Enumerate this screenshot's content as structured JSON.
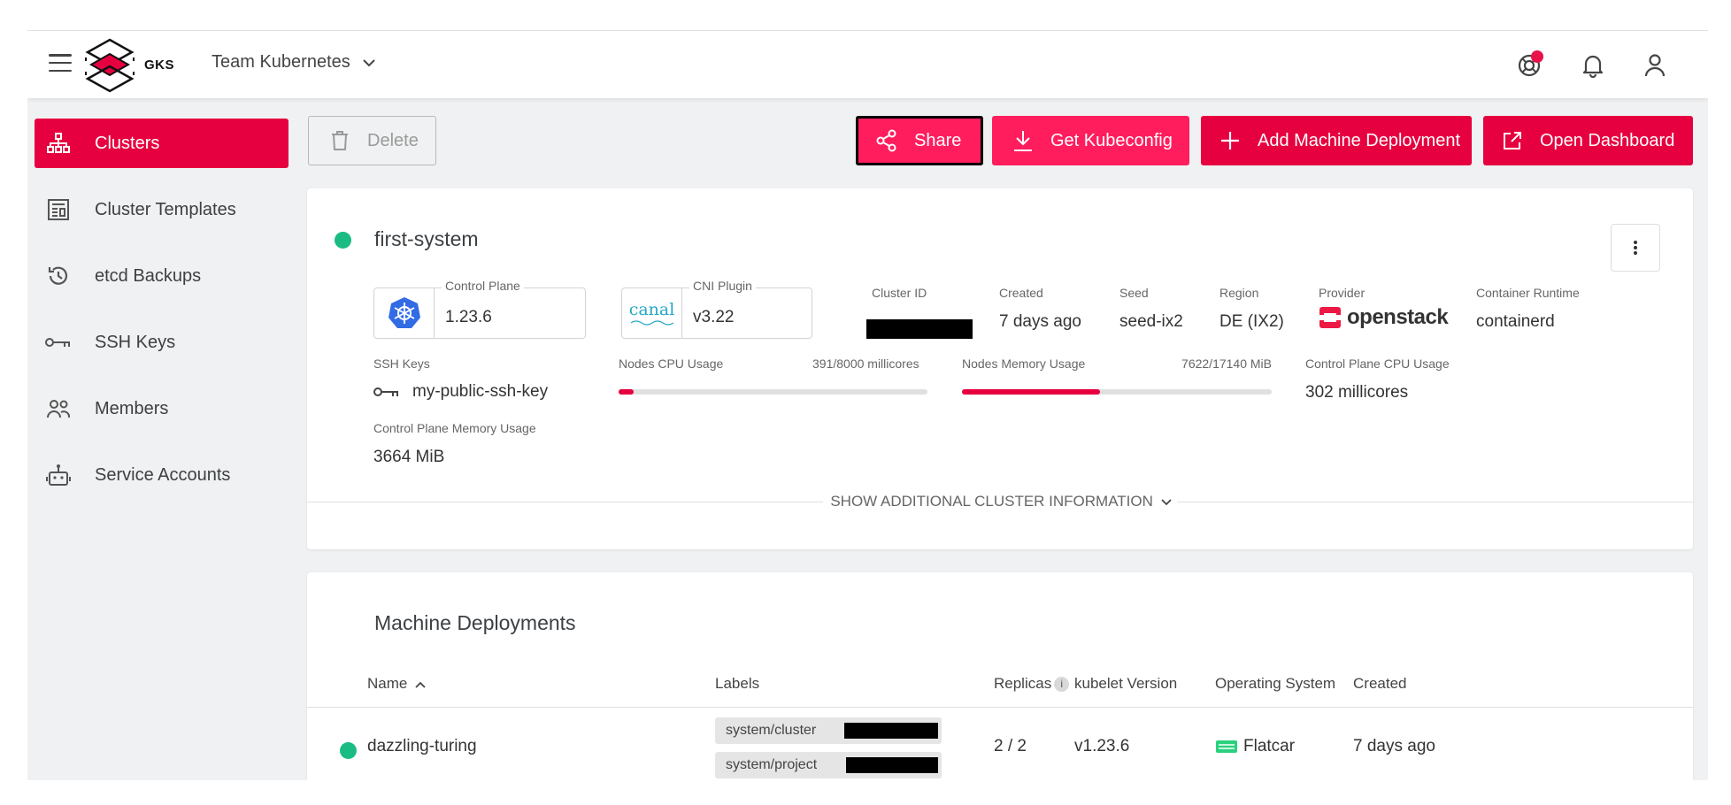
{
  "header": {
    "logo_text": "GKS",
    "project": "Team Kubernetes"
  },
  "sidebar": {
    "items": [
      {
        "label": "Clusters",
        "icon": "sitemap-icon",
        "active": true
      },
      {
        "label": "Cluster Templates",
        "icon": "template-icon"
      },
      {
        "label": "etcd Backups",
        "icon": "history-icon"
      },
      {
        "label": "SSH Keys",
        "icon": "key-icon"
      },
      {
        "label": "Members",
        "icon": "members-icon"
      },
      {
        "label": "Service Accounts",
        "icon": "robot-icon"
      }
    ]
  },
  "toolbar": {
    "delete_label": "Delete",
    "share_label": "Share",
    "kubeconfig_label": "Get Kubeconfig",
    "add_md_label": "Add Machine Deployment",
    "dashboard_label": "Open Dashboard"
  },
  "cluster": {
    "name": "first-system",
    "status_color": "#1bbc84",
    "control_plane_label": "Control Plane",
    "control_plane_version": "1.23.6",
    "cni_label": "CNI Plugin",
    "cni_logo_text": "canal",
    "cni_version": "v3.22",
    "cluster_id_label": "Cluster ID",
    "created_label": "Created",
    "created_value": "7 days ago",
    "seed_label": "Seed",
    "seed_value": "seed-ix2",
    "region_label": "Region",
    "region_value": "DE (IX2)",
    "provider_label": "Provider",
    "provider_value": "openstack",
    "runtime_label": "Container Runtime",
    "runtime_value": "containerd",
    "ssh_label": "SSH Keys",
    "ssh_value": "my-public-ssh-key",
    "cpu_label": "Nodes CPU Usage",
    "cpu_value": "391/8000 millicores",
    "cpu_fraction": 0.049,
    "mem_label": "Nodes Memory Usage",
    "mem_value": "7622/17140 MiB",
    "mem_fraction": 0.445,
    "cp_cpu_label": "Control Plane CPU Usage",
    "cp_cpu_value": "302 millicores",
    "cp_mem_label": "Control Plane Memory Usage",
    "cp_mem_value": "3664 MiB",
    "show_more": "SHOW ADDITIONAL CLUSTER INFORMATION"
  },
  "machine_deployments": {
    "title": "Machine Deployments",
    "columns": {
      "name": "Name",
      "labels": "Labels",
      "replicas": "Replicas",
      "kubelet": "kubelet Version",
      "os": "Operating System",
      "created": "Created"
    },
    "rows": [
      {
        "name": "dazzling-turing",
        "labels": [
          "system/cluster",
          "system/project"
        ],
        "replicas": "2 / 2",
        "kubelet": "v1.23.6",
        "os": "Flatcar",
        "created": "7 days ago"
      }
    ]
  }
}
